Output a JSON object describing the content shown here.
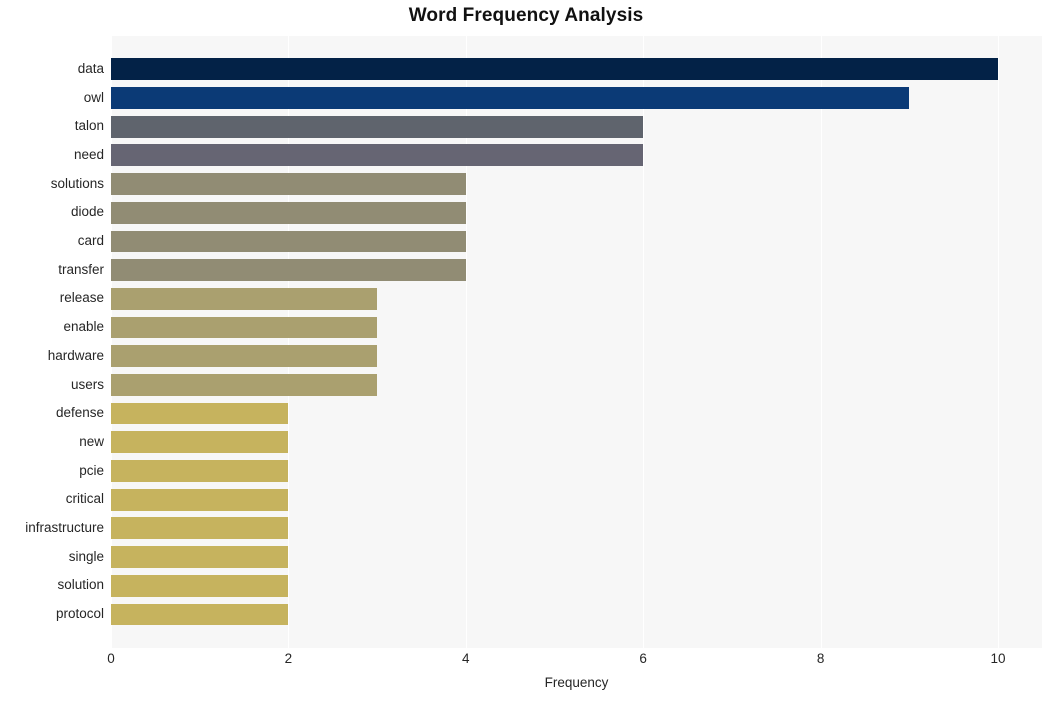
{
  "chart_data": {
    "type": "bar",
    "orientation": "horizontal",
    "title": "Word Frequency Analysis",
    "xlabel": "Frequency",
    "ylabel": "",
    "xlim": [
      0,
      10
    ],
    "ylim": [
      0,
      20
    ],
    "xticks": [
      "0",
      "2",
      "4",
      "6",
      "8",
      "10"
    ],
    "xtick_values": [
      0,
      2,
      4,
      6,
      8,
      10
    ],
    "grid": true,
    "grid_axis": "x",
    "legend": null,
    "categories": [
      "data",
      "owl",
      "talon",
      "need",
      "solutions",
      "diode",
      "card",
      "transfer",
      "release",
      "enable",
      "hardware",
      "users",
      "defense",
      "new",
      "pcie",
      "critical",
      "infrastructure",
      "single",
      "solution",
      "protocol"
    ],
    "values": [
      10,
      9,
      6,
      6,
      4,
      4,
      4,
      4,
      3,
      3,
      3,
      3,
      2,
      2,
      2,
      2,
      2,
      2,
      2,
      2
    ],
    "bar_colors": [
      "#032247",
      "#0b3a76",
      "#5f646d",
      "#666573",
      "#918c74",
      "#918c74",
      "#918c74",
      "#918c74",
      "#aaa06f",
      "#aaa06f",
      "#aaa06f",
      "#aaa06f",
      "#c6b35e",
      "#c6b35e",
      "#c6b35e",
      "#c6b35e",
      "#c6b35e",
      "#c6b35e",
      "#c6b35e",
      "#c6b35e"
    ],
    "plot_background": "#f7f7f7",
    "gridline_color": "#ffffff",
    "figure_background": "#ffffff",
    "text_color": "#262626",
    "title_color": "#111111"
  }
}
